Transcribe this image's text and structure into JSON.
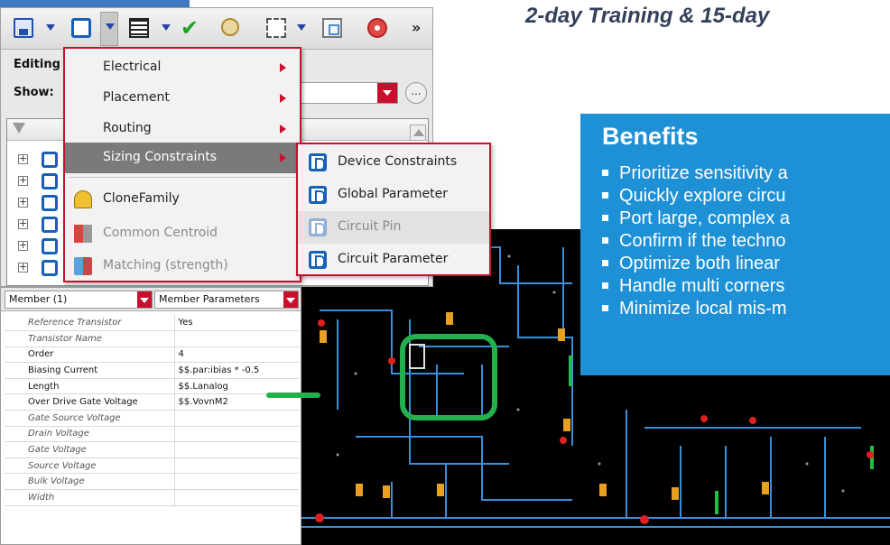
{
  "headline": "2-day Training & 15-day",
  "benefits": {
    "title": "Benefits",
    "items": [
      "Prioritize sensitivity a",
      "Quickly explore circu",
      "Port large, complex a",
      "Confirm if the techno",
      "Optimize both linear",
      "Handle multi corners",
      "Minimize local mis-m"
    ]
  },
  "toolbar": {
    "overflow_label": "»"
  },
  "panel": {
    "editing_label": "Editing",
    "show_label": "Show:",
    "more_button_label": "..."
  },
  "context_menu": {
    "items": [
      {
        "label": "Electrical"
      },
      {
        "label": "Placement"
      },
      {
        "label": "Routing"
      },
      {
        "label": "Sizing Constraints"
      },
      {
        "label": "CloneFamily"
      },
      {
        "label": "Common Centroid"
      },
      {
        "label": "Matching (strength)"
      }
    ]
  },
  "submenu": {
    "items": [
      {
        "label": "Device Constraints"
      },
      {
        "label": "Global Parameter"
      },
      {
        "label": "Circuit Pin"
      },
      {
        "label": "Circuit Parameter"
      }
    ]
  },
  "member_panel": {
    "member_select": "Member (1)",
    "params_select": "Member Parameters",
    "rows": [
      {
        "name": "Reference Transistor",
        "value": "Yes"
      },
      {
        "name": "Transistor Name",
        "value": ""
      },
      {
        "name": "Order",
        "value": "4"
      },
      {
        "name": "Biasing Current",
        "value": "$$.par:ibias * -0.5"
      },
      {
        "name": "Length",
        "value": "$$.Lanalog"
      },
      {
        "name": "Over Drive Gate Voltage",
        "value": "$$.VovnM2"
      },
      {
        "name": "Gate Source Voltage",
        "value": ""
      },
      {
        "name": "Drain Voltage",
        "value": ""
      },
      {
        "name": "Gate Voltage",
        "value": ""
      },
      {
        "name": "Source Voltage",
        "value": ""
      },
      {
        "name": "Bulk Voltage",
        "value": ""
      },
      {
        "name": "Width",
        "value": ""
      }
    ]
  },
  "colors": {
    "accent_red": "#c8102e",
    "benefits_blue": "#1e91d6",
    "annotation_green": "#22b14c",
    "wire_blue": "#3a8fd8"
  }
}
